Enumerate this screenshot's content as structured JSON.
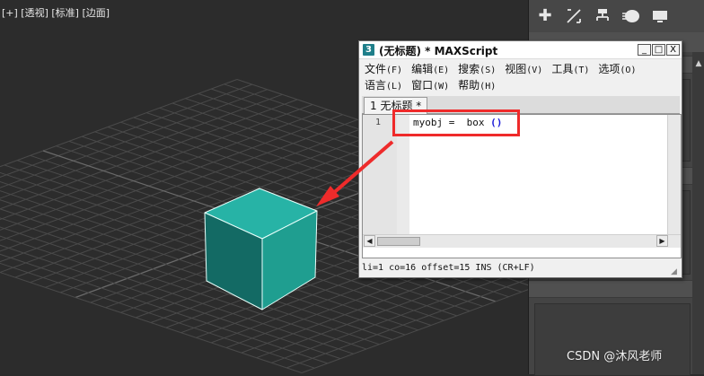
{
  "viewport": {
    "label": "[+] [透视] [标准] [边面]",
    "object_color": "#1f9e90"
  },
  "command_panel": {
    "icons": [
      "create-icon",
      "modify-icon",
      "hierarchy-icon",
      "motion-icon",
      "display-icon"
    ]
  },
  "maxscript_window": {
    "app_icon_text": "3",
    "title": "(无标题) * MAXScript",
    "minimize": "_",
    "maximize": "□",
    "close": "X",
    "menu_row1": [
      {
        "label": "文件",
        "accel": "(F)"
      },
      {
        "label": "编辑",
        "accel": "(E)"
      },
      {
        "label": "搜索",
        "accel": "(S)"
      },
      {
        "label": "视图",
        "accel": "(V)"
      },
      {
        "label": "工具",
        "accel": "(T)"
      },
      {
        "label": "选项",
        "accel": "(O)"
      }
    ],
    "menu_row2": [
      {
        "label": "语言",
        "accel": "(L)"
      },
      {
        "label": "窗口",
        "accel": "(W)"
      },
      {
        "label": "帮助",
        "accel": "(H)"
      }
    ],
    "tab_label": "1 无标题 *",
    "line_number": "1",
    "code_text": "myobj =  box ",
    "code_paren": "()",
    "status": "li=1 co=16 offset=15 INS (CR+LF)"
  },
  "watermark": "CSDN @沐风老师"
}
